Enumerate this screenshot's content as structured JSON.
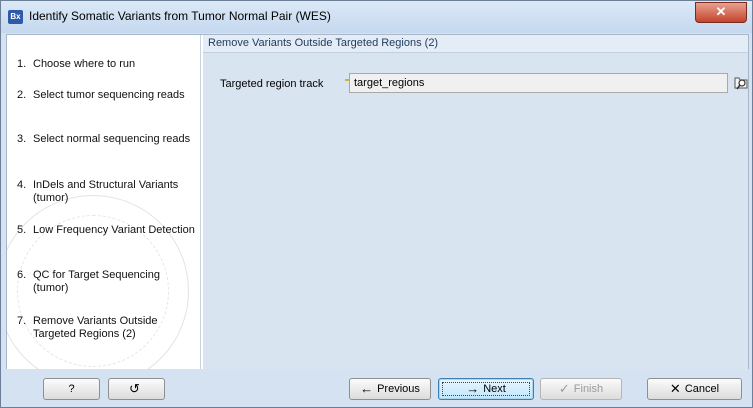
{
  "window": {
    "icon_text": "Bx",
    "title": "Identify Somatic Variants from Tumor Normal Pair (WES)",
    "close_glyph": "✕"
  },
  "steps": [
    {
      "num": "1.",
      "label": "Choose where to run"
    },
    {
      "num": "2.",
      "label": "Select tumor sequencing reads"
    },
    {
      "num": "3.",
      "label": "Select normal sequencing reads"
    },
    {
      "num": "4.",
      "label": "InDels and Structural Variants (tumor)"
    },
    {
      "num": "5.",
      "label": "Low Frequency Variant Detection"
    },
    {
      "num": "6.",
      "label": "QC for Target Sequencing (tumor)"
    },
    {
      "num": "7.",
      "label": "Remove Variants Outside Targeted Regions (2)"
    }
  ],
  "content": {
    "section_title": "Remove Variants Outside Targeted Regions (2)",
    "field_label": "Targeted region track",
    "field_value": "target_regions",
    "track_icon": "track-icon",
    "browse_icon": "browse-icon"
  },
  "buttons": {
    "help": "?",
    "reset": "↺",
    "previous": "Previous",
    "previous_icon": "←",
    "next": "Next",
    "next_icon": "→",
    "finish": "Finish",
    "finish_icon": "✓",
    "cancel": "Cancel",
    "cancel_icon": "✕"
  },
  "colors": {
    "titlebar": "#c5d8ee",
    "panel": "#d9e4f1",
    "close": "#c4442c",
    "focus": "#3c7fb1"
  }
}
